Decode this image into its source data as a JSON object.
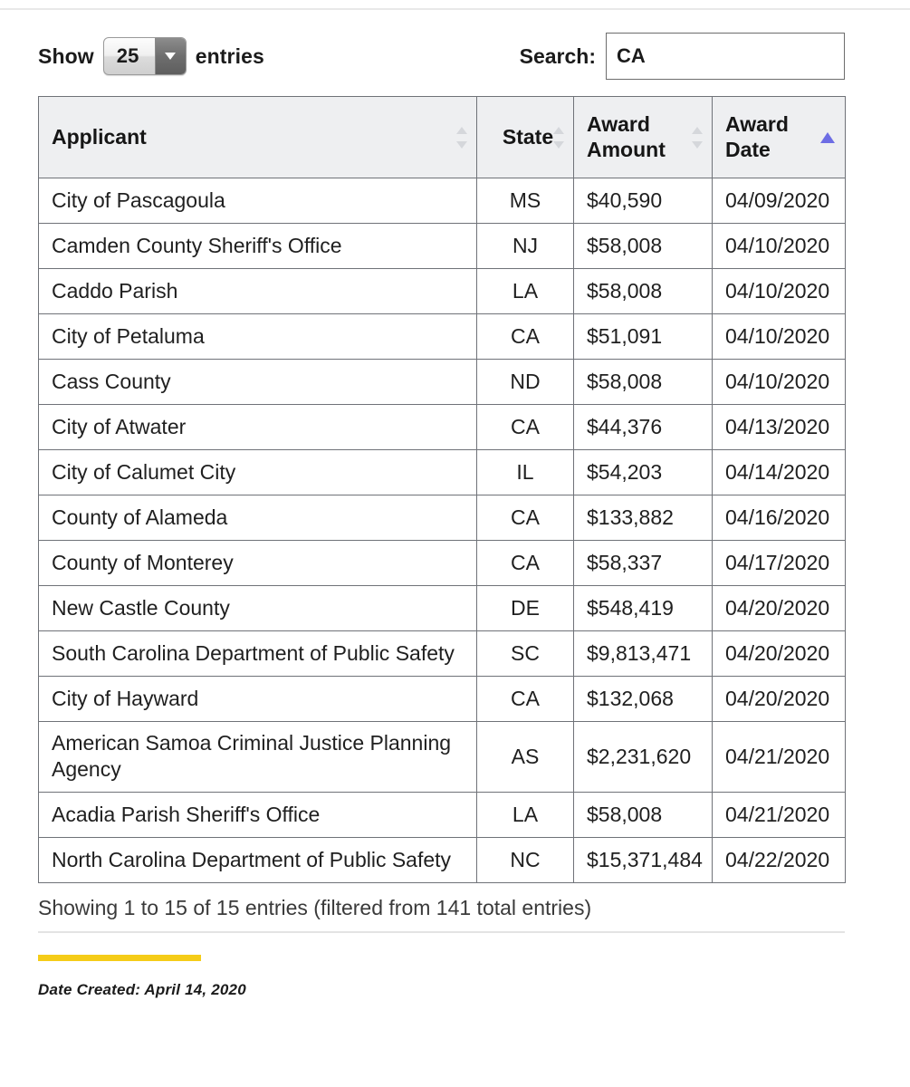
{
  "controls": {
    "length_prefix": "Show",
    "length_value": "25",
    "length_suffix": "entries",
    "length_caret_icon": "chevron-down-icon",
    "search_label": "Search:",
    "search_value": "CA",
    "search_placeholder": ""
  },
  "table": {
    "columns": [
      {
        "key": "applicant",
        "label": "Applicant",
        "sort": "none"
      },
      {
        "key": "state",
        "label": "State",
        "sort": "none"
      },
      {
        "key": "amount",
        "label": "Award Amount",
        "sort": "none"
      },
      {
        "key": "date",
        "label": "Award Date",
        "sort": "asc"
      }
    ],
    "sort_icons": {
      "none": "sort-both-icon",
      "asc": "sort-ascending-icon"
    },
    "rows": [
      {
        "applicant": "City of Pascagoula",
        "state": "MS",
        "amount": "$40,590",
        "date": "04/09/2020"
      },
      {
        "applicant": "Camden County Sheriff's Office",
        "state": "NJ",
        "amount": "$58,008",
        "date": "04/10/2020"
      },
      {
        "applicant": "Caddo Parish",
        "state": "LA",
        "amount": "$58,008",
        "date": "04/10/2020"
      },
      {
        "applicant": "City of Petaluma",
        "state": "CA",
        "amount": "$51,091",
        "date": "04/10/2020"
      },
      {
        "applicant": "Cass County",
        "state": "ND",
        "amount": "$58,008",
        "date": "04/10/2020"
      },
      {
        "applicant": "City of Atwater",
        "state": "CA",
        "amount": "$44,376",
        "date": "04/13/2020"
      },
      {
        "applicant": "City of Calumet City",
        "state": "IL",
        "amount": "$54,203",
        "date": "04/14/2020"
      },
      {
        "applicant": "County of Alameda",
        "state": "CA",
        "amount": "$133,882",
        "date": "04/16/2020"
      },
      {
        "applicant": "County of Monterey",
        "state": "CA",
        "amount": "$58,337",
        "date": "04/17/2020"
      },
      {
        "applicant": "New Castle County",
        "state": "DE",
        "amount": "$548,419",
        "date": "04/20/2020"
      },
      {
        "applicant": "South Carolina Department of Public Safety",
        "state": "SC",
        "amount": "$9,813,471",
        "date": "04/20/2020"
      },
      {
        "applicant": "City of Hayward",
        "state": "CA",
        "amount": "$132,068",
        "date": "04/20/2020"
      },
      {
        "applicant": "American Samoa Criminal Justice Planning Agency",
        "state": "AS",
        "amount": "$2,231,620",
        "date": "04/21/2020"
      },
      {
        "applicant": "Acadia Parish Sheriff's Office",
        "state": "LA",
        "amount": "$58,008",
        "date": "04/21/2020"
      },
      {
        "applicant": "North Carolina Department of Public Safety",
        "state": "NC",
        "amount": "$15,371,484",
        "date": "04/22/2020"
      }
    ]
  },
  "footer": {
    "info": "Showing 1 to 15 of 15 entries (filtered from 141 total entries)",
    "accent_color": "#f5cc18",
    "date_created": "Date Created: April 14, 2020"
  }
}
